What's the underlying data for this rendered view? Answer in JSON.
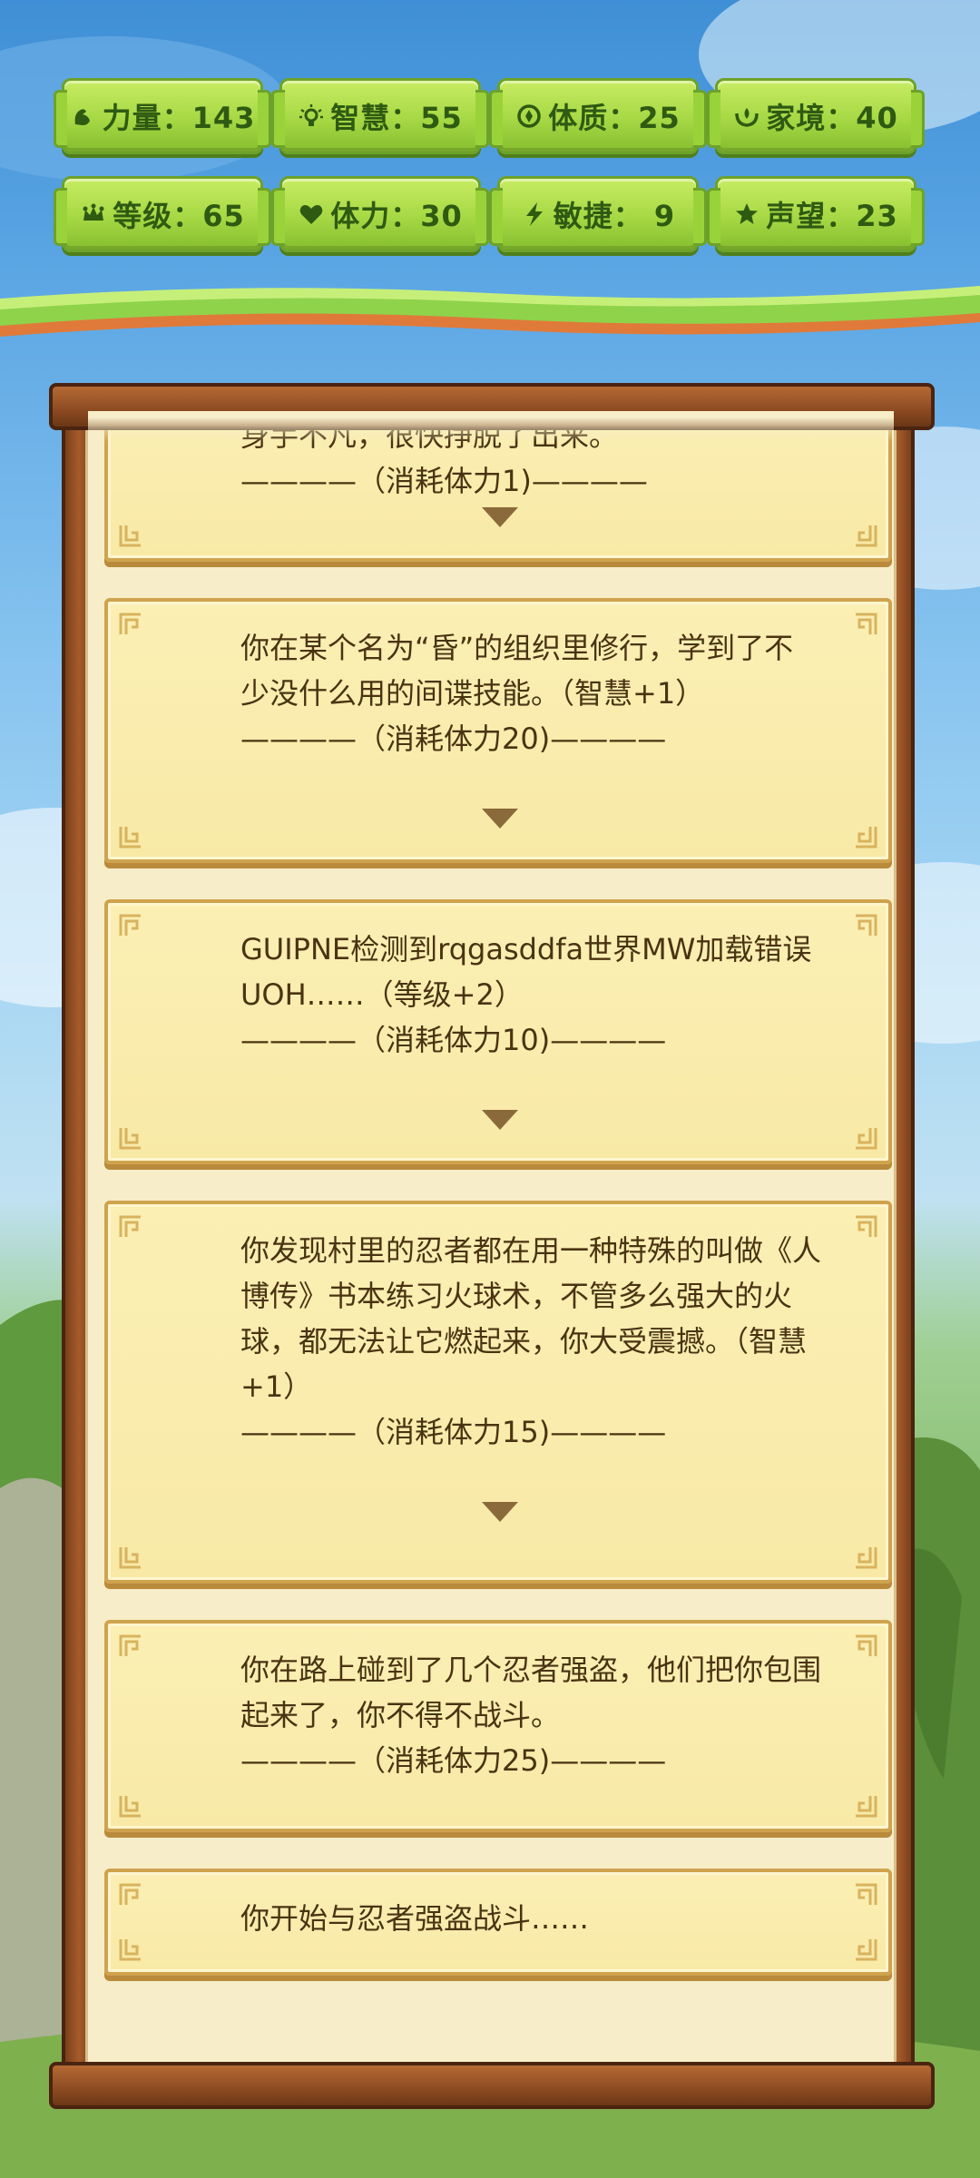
{
  "stats": [
    {
      "icon": "strength-icon",
      "label": "力量：143"
    },
    {
      "icon": "wisdom-icon",
      "label": "智慧：55"
    },
    {
      "icon": "constitution-icon",
      "label": "体质：25"
    },
    {
      "icon": "family-icon",
      "label": "家境：40"
    },
    {
      "icon": "crown-icon",
      "label": "等级：65"
    },
    {
      "icon": "heart-icon",
      "label": "体力：30"
    },
    {
      "icon": "lightning-icon",
      "label": "敏捷：  9"
    },
    {
      "icon": "star-icon",
      "label": "声望：23"
    }
  ],
  "events": [
    {
      "text": "身手不凡，很快挣脱了出来。",
      "cost": "————（消耗体力1)————",
      "expandable": true
    },
    {
      "text": "你在某个名为“昏”的组织里修行，学到了不少没什么用的间谍技能。（智慧+1）",
      "cost": "————（消耗体力20)————",
      "expandable": true
    },
    {
      "text": "GUIPNE检测到rqgasddfa世界MW加载错误UOH……（等级+2）",
      "cost": "————（消耗体力10)————",
      "expandable": true
    },
    {
      "text": "你发现村里的忍者都在用一种特殊的叫做《人博传》书本练习火球术，不管多么强大的火球，都无法让它燃起来，你大受震撼。（智慧+1）",
      "cost": "————（消耗体力15)————",
      "expandable": true
    },
    {
      "text": "你在路上碰到了几个忍者强盗，他们把你包围起来了，你不得不战斗。",
      "cost": "————（消耗体力25)————",
      "expandable": false
    },
    {
      "text": "你开始与忍者强盗战斗……",
      "cost": "",
      "expandable": false
    }
  ],
  "colors": {
    "stat_green": "#a6d844",
    "card_bg": "#f8e9a6",
    "card_border": "#cfa34e",
    "text_brown": "#4a3312",
    "wood": "#8c4a22"
  }
}
